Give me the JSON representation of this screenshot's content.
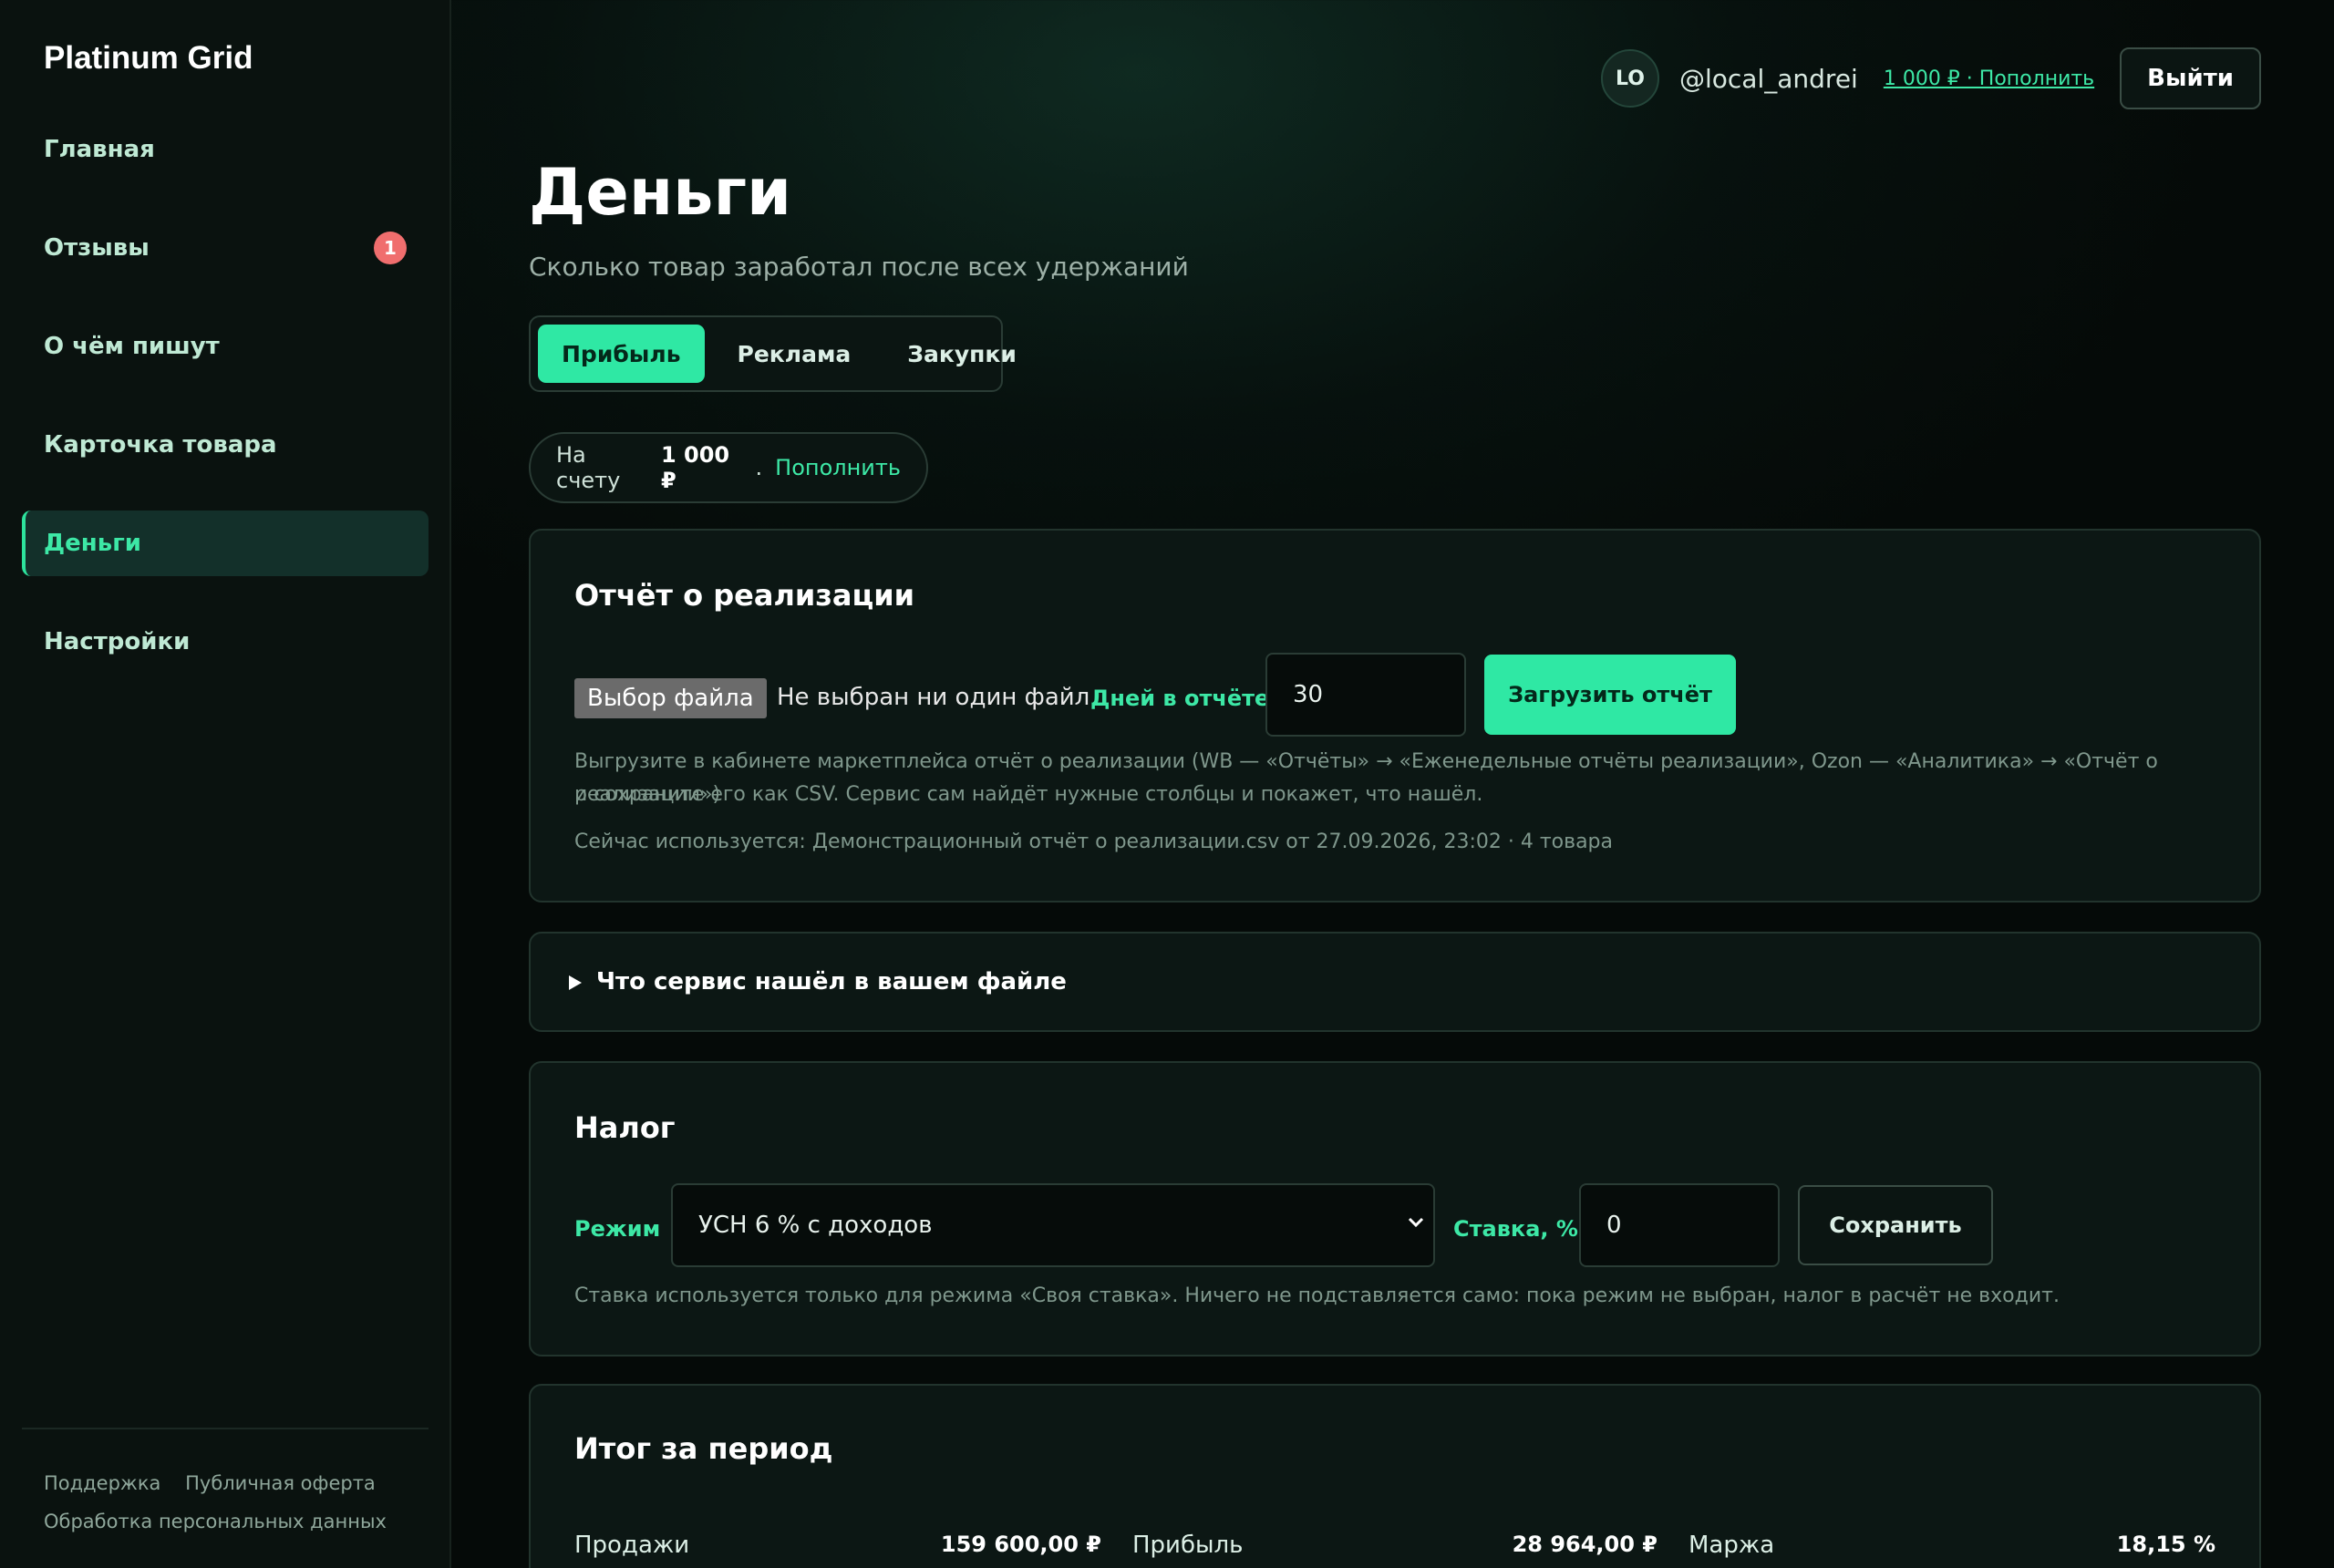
{
  "app": {
    "brand": "Platinum Grid"
  },
  "sidebar": {
    "items": [
      {
        "label": "Главная"
      },
      {
        "label": "Отзывы",
        "badge": "1"
      },
      {
        "label": "О чём пишут"
      },
      {
        "label": "Карточка товара"
      },
      {
        "label": "Деньги",
        "active": true
      },
      {
        "label": "Настройки"
      }
    ],
    "footer_links": [
      "Поддержка",
      "Публичная оферта",
      "Обработка персональных данных"
    ]
  },
  "header": {
    "avatar_initials": "LO",
    "username": "@local_andrei",
    "balance_link": "1 000 ₽ · Пополнить",
    "logout_label": "Выйти"
  },
  "page": {
    "title": "Деньги",
    "subtitle": "Сколько товар заработал после всех удержаний",
    "tabs": [
      {
        "label": "Прибыль",
        "active": true
      },
      {
        "label": "Реклама"
      },
      {
        "label": "Закупки"
      }
    ]
  },
  "balance": {
    "label": "На счету",
    "amount": "1 000 ₽",
    "separator": ".",
    "topup_label": "Пополнить"
  },
  "report": {
    "title": "Отчёт о реализации",
    "file_button": "Выбор файла",
    "file_status": "Не выбран ни один файл",
    "days_label": "Дней в отчёте",
    "days_value": "30",
    "upload_label": "Загрузить отчёт",
    "hint_line1": "Выгрузите в кабинете маркетплейса отчёт о реализации (WB — «Отчёты» → «Еженедельные отчёты реализации», Ozon — «Аналитика» → «Отчёт о реализации»)",
    "hint_line2": "и сохраните его как CSV. Сервис сам найдёт нужные столбцы и покажет, что нашёл.",
    "current": "Сейчас используется: Демонстрационный отчёт о реализации.csv от 27.09.2026, 23:02 · 4 товара"
  },
  "details": {
    "summary_label": "Что сервис нашёл в вашем файле"
  },
  "tax": {
    "title": "Налог",
    "mode_label": "Режим",
    "mode_value": "УСН 6 % с доходов",
    "rate_label": "Ставка, %",
    "rate_value": "0",
    "save_label": "Сохранить",
    "hint": "Ставка используется только для режима «Своя ставка». Ничего не подставляется само: пока режим не выбран, налог в расчёт не входит."
  },
  "summary": {
    "title": "Итог за период",
    "items": [
      {
        "label": "Продажи",
        "value": "159 600,00 ₽"
      },
      {
        "label": "Прибыль",
        "value": "28 964,00 ₽"
      },
      {
        "label": "Маржа",
        "value": "18,15 %"
      }
    ]
  },
  "colors": {
    "accent": "#2fe8a4",
    "badge": "#f06e6e",
    "background": "#07110e"
  }
}
